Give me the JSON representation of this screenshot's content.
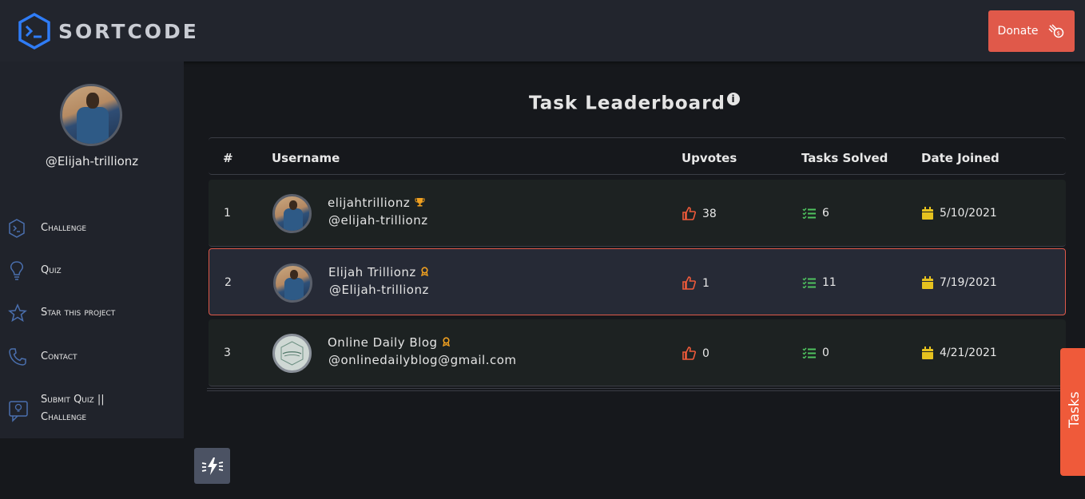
{
  "header": {
    "brand": "SORTCODE",
    "donate_label": "Donate"
  },
  "sidebar": {
    "profile_handle": "@Elijah-trillionz",
    "items": [
      {
        "label": "Challenge",
        "icon": "hexagon-code-icon"
      },
      {
        "label": "Quiz",
        "icon": "lightbulb-icon"
      },
      {
        "label": "Star this project",
        "icon": "star-icon"
      },
      {
        "label": "Contact",
        "icon": "phone-icon"
      },
      {
        "label": "Submit Quiz ||",
        "label2": "Challenge",
        "icon": "chat-bulb-icon"
      }
    ]
  },
  "leaderboard": {
    "title": "Task Leaderboard",
    "columns": {
      "rank": "#",
      "username": "Username",
      "upvotes": "Upvotes",
      "tasks": "Tasks Solved",
      "joined": "Date Joined"
    },
    "rows": [
      {
        "rank": "1",
        "name": "elijahtrillionz",
        "badge": "trophy",
        "handle": "@elijah-trillionz",
        "upvotes": "38",
        "tasks": "6",
        "joined": "5/10/2021"
      },
      {
        "rank": "2",
        "name": "Elijah Trillionz",
        "badge": "award",
        "handle": "@Elijah-trillionz",
        "upvotes": "1",
        "tasks": "11",
        "joined": "7/19/2021"
      },
      {
        "rank": "3",
        "name": "Online Daily Blog",
        "badge": "award",
        "handle": "@onlinedailyblog@gmail.com",
        "upvotes": "0",
        "tasks": "0",
        "joined": "4/21/2021"
      }
    ]
  },
  "tasks_tab_label": "Tasks",
  "colors": {
    "accent": "#e0594a",
    "tasks_icon": "#4fc35f",
    "calendar_icon": "#e6c21f",
    "trophy": "#f0a020"
  }
}
